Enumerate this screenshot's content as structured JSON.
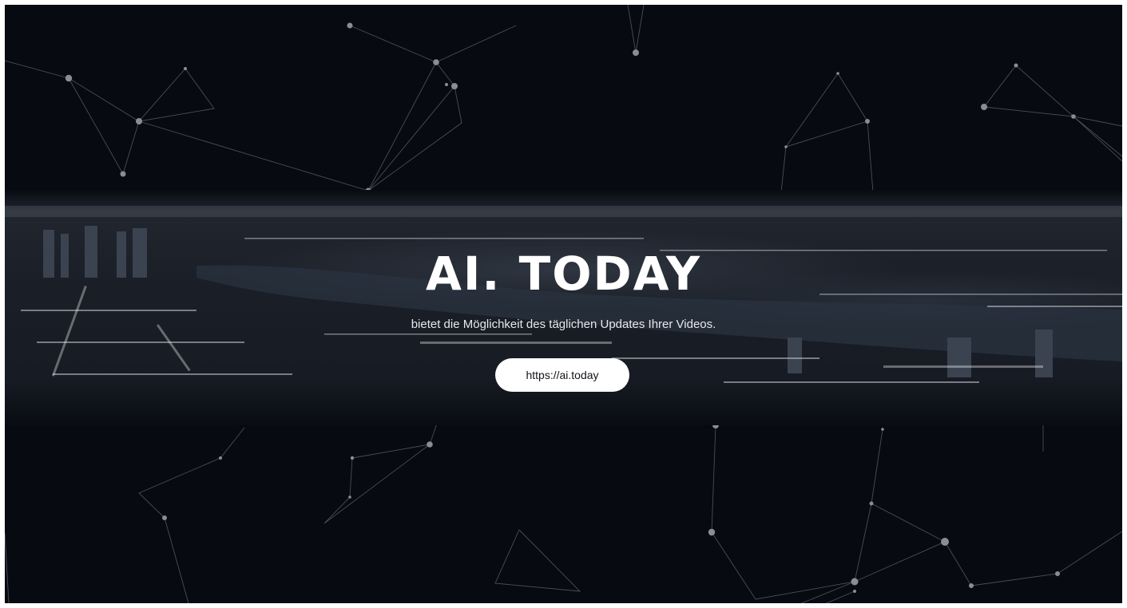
{
  "banner": {
    "title": "AI. TODAY",
    "tagline": "bietet die Möglichkeit des täglichen Updates Ihrer Videos.",
    "cta_label": "https://ai.today"
  },
  "colors": {
    "background": "#070a10",
    "network_line": "#5a5f68",
    "network_node": "#8a8d93",
    "title": "#ffffff",
    "button_bg": "#ffffff",
    "button_text": "#111318"
  }
}
